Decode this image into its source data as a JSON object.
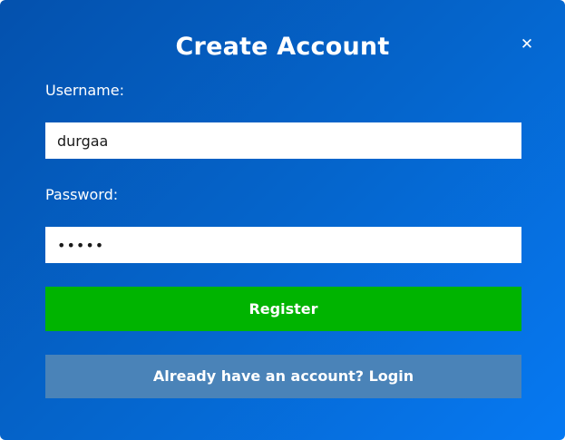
{
  "window": {
    "title": "Create Account",
    "close_glyph": "✕",
    "close_icon": "close-icon"
  },
  "form": {
    "username_label": "Username:",
    "username_value": "durgaa",
    "password_label": "Password:",
    "password_value": "durga",
    "register_label": "Register",
    "login_label": "Already have an account? Login"
  },
  "colors": {
    "background_start": "#0451ad",
    "background_end": "#0679f2",
    "register_button": "#00b400",
    "login_button": "#4a83b8"
  }
}
